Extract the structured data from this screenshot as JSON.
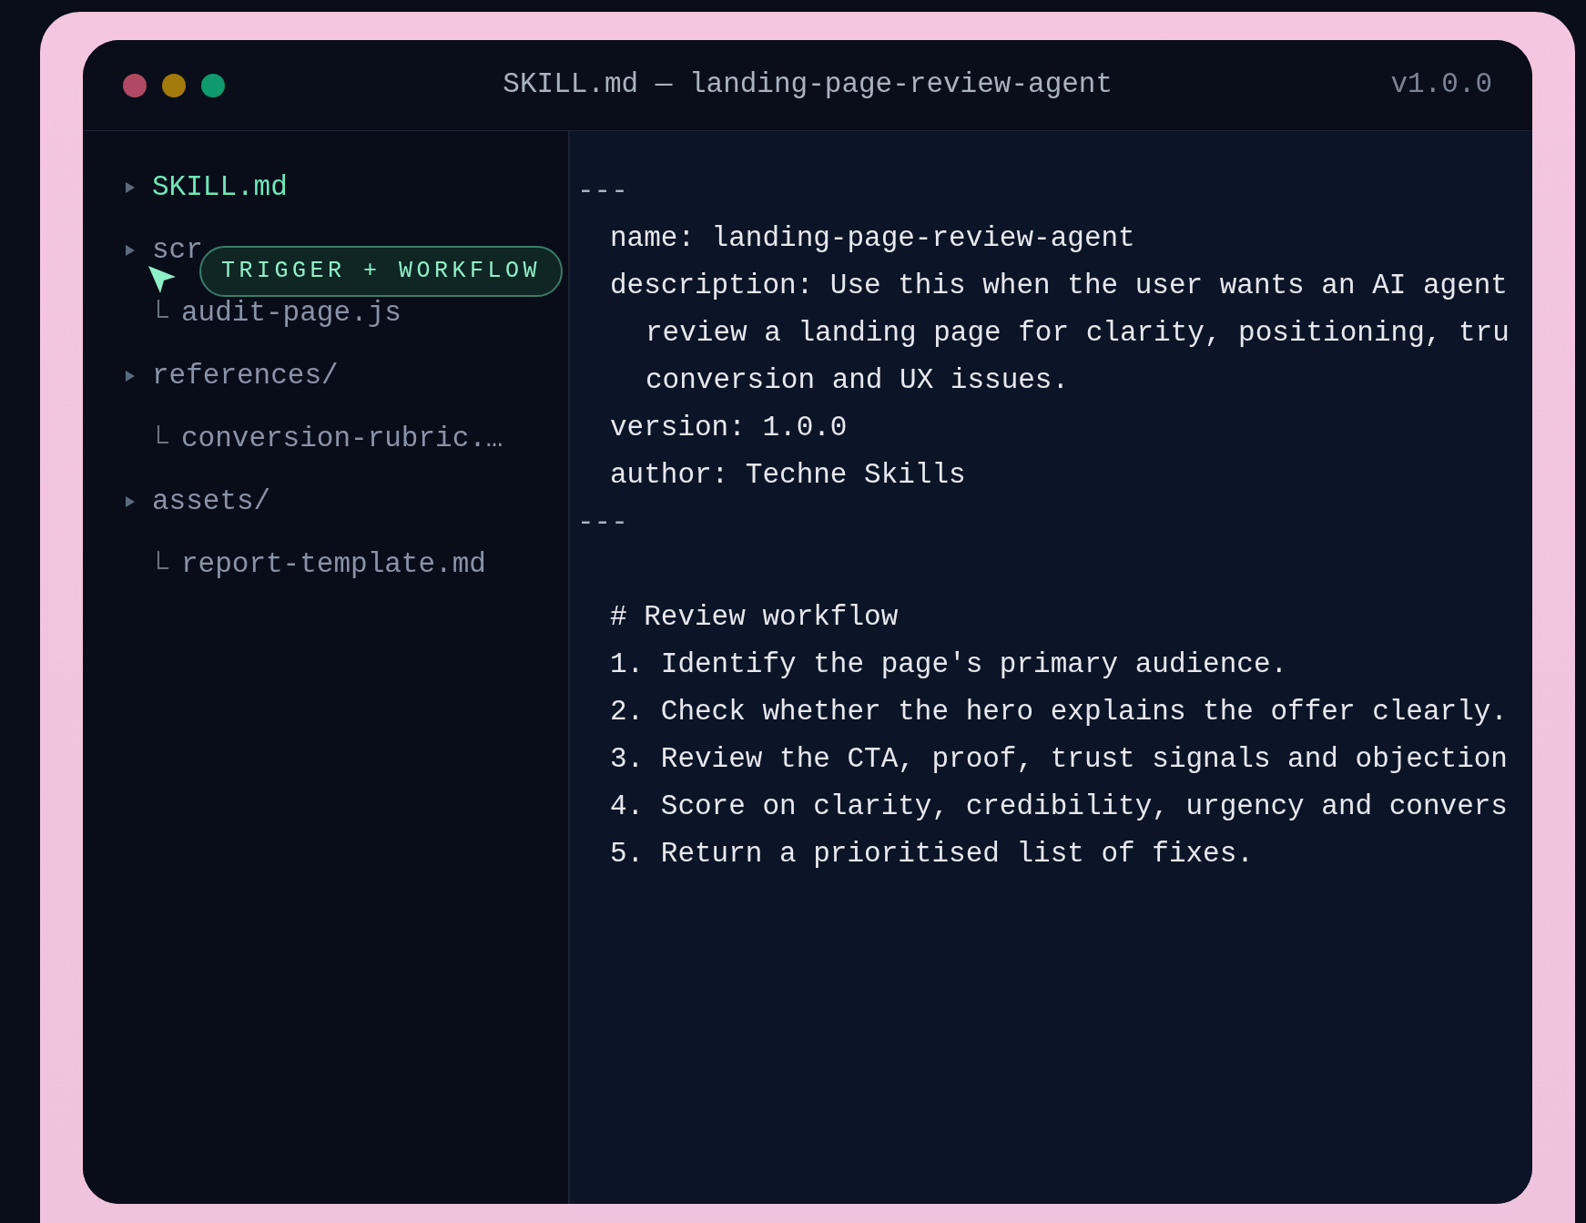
{
  "window": {
    "title": "SKILL.md — landing-page-review-agent",
    "version": "v1.0.0"
  },
  "file_tree": [
    {
      "name": "SKILL.md",
      "selected": true
    },
    {
      "name": "scr",
      "selected": false,
      "children": [
        {
          "name": "audit-page.js",
          "selected": false
        }
      ]
    },
    {
      "name": "references/",
      "selected": false,
      "children": [
        {
          "name": "conversion-rubric.…",
          "selected": false
        }
      ]
    },
    {
      "name": "assets/",
      "selected": false,
      "children": [
        {
          "name": "report-template.md",
          "selected": false
        }
      ]
    }
  ],
  "tooltip": {
    "label": "TRIGGER + WORKFLOW"
  },
  "editor": {
    "lines": [
      {
        "kind": "rule",
        "text": "---"
      },
      {
        "kind": "field",
        "text": "name: landing-page-review-agent"
      },
      {
        "kind": "field",
        "text": "description: Use this when the user wants an AI agent"
      },
      {
        "kind": "continuation",
        "text": "review a landing page for clarity, positioning, tru"
      },
      {
        "kind": "continuation",
        "text": "conversion and UX issues."
      },
      {
        "kind": "field",
        "text": "version: 1.0.0"
      },
      {
        "kind": "field",
        "text": "author: Techne Skills"
      },
      {
        "kind": "rule",
        "text": "---"
      },
      {
        "kind": "blank"
      },
      {
        "kind": "field",
        "text": "# Review workflow"
      },
      {
        "kind": "field",
        "text": "1. Identify the page's primary audience."
      },
      {
        "kind": "field",
        "text": "2. Check whether the hero explains the offer clearly."
      },
      {
        "kind": "field",
        "text": "3. Review the CTA, proof, trust signals and objection"
      },
      {
        "kind": "field",
        "text": "4. Score on clarity, credibility, urgency and convers"
      },
      {
        "kind": "field",
        "text": "5. Return a prioritised list of fixes."
      }
    ]
  }
}
